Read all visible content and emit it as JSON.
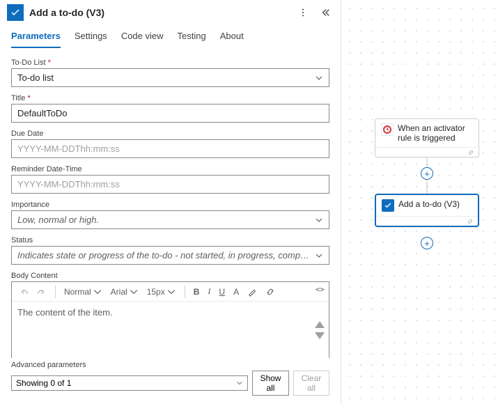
{
  "header": {
    "title": "Add a to-do (V3)"
  },
  "tabs": [
    "Parameters",
    "Settings",
    "Code view",
    "Testing",
    "About"
  ],
  "activeTab": 0,
  "fields": {
    "todoList": {
      "label": "To-Do List",
      "required": true,
      "value": "To-do list"
    },
    "title": {
      "label": "Title",
      "required": true,
      "value": "DefaultToDo"
    },
    "dueDate": {
      "label": "Due Date",
      "placeholder": "YYYY-MM-DDThh:mm:ss"
    },
    "reminder": {
      "label": "Reminder Date-Time",
      "placeholder": "YYYY-MM-DDThh:mm:ss"
    },
    "importance": {
      "label": "Importance",
      "placeholder": "Low, normal or high."
    },
    "status": {
      "label": "Status",
      "placeholder": "Indicates state or progress of the to-do - not started, in progress, completed, waiting on o..."
    },
    "body": {
      "label": "Body Content",
      "placeholder": "The content of the item."
    }
  },
  "editorToolbar": {
    "style": "Normal",
    "font": "Arial",
    "size": "15px"
  },
  "advanced": {
    "label": "Advanced parameters",
    "showing": "Showing 0 of 1",
    "showAll": "Show all",
    "clearAll": "Clear all"
  },
  "canvas": {
    "trigger": {
      "label": "When an activator rule is triggered"
    },
    "action": {
      "label": "Add a to-do (V3)"
    }
  }
}
